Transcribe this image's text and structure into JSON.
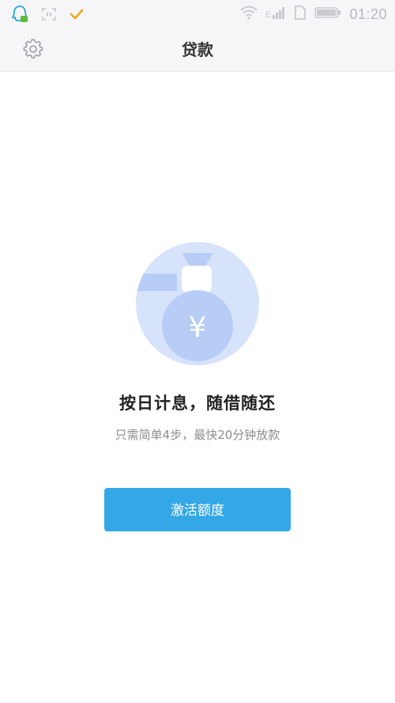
{
  "status_bar": {
    "time": "01:20",
    "icons": [
      "qq-icon",
      "scan-icon",
      "check-icon",
      "wifi-icon",
      "signal-icon",
      "sim-icon",
      "battery-icon"
    ]
  },
  "nav": {
    "title": "贷款",
    "settings_icon": "gear-icon"
  },
  "hero": {
    "illustration": "money-bag-icon",
    "currency_symbol": "¥",
    "headline": "按日计息，随借随还",
    "subline": "只需简单4步，最快20分钟放款"
  },
  "actions": {
    "activate_label": "激活额度"
  },
  "colors": {
    "accent": "#34a7e6",
    "illustration_bg": "#d7e3fb",
    "illustration_fg": "#b7cdf5",
    "nav_bg": "#f6f6f8"
  }
}
